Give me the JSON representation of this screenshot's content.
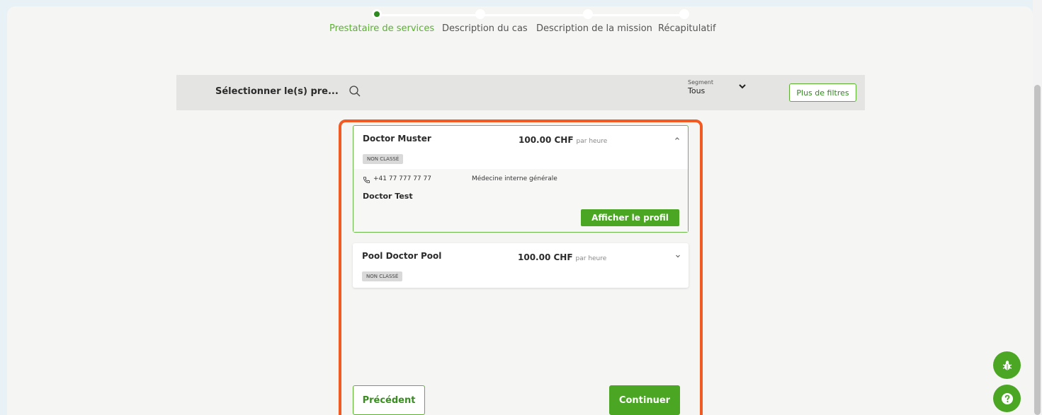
{
  "stepper": {
    "steps": [
      {
        "label": "Prestataire de services",
        "active": true
      },
      {
        "label": "Description du cas",
        "active": false
      },
      {
        "label": "Description de la mission",
        "active": false
      },
      {
        "label": "Récapitulatif",
        "active": false
      }
    ]
  },
  "filter": {
    "title": "Sélectionner le(s) pre...",
    "segment_label": "Segment",
    "segment_value": "Tous",
    "more_filters": "Plus de filtres"
  },
  "providers": [
    {
      "name": "Doctor Muster",
      "price": "100.00 CHF",
      "unit": "par heure",
      "badge": "NON CLASSÉ",
      "expanded": true,
      "phone": "+41 77 777 77 77",
      "specialty": "Médecine interne générale",
      "contact": "Doctor Test",
      "profile_button": "Afficher le profil"
    },
    {
      "name": "Pool Doctor Pool",
      "price": "100.00 CHF",
      "unit": "par heure",
      "badge": "NON CLASSÉ",
      "expanded": false
    }
  ],
  "actions": {
    "previous": "Précédent",
    "continue": "Continuer"
  },
  "colors": {
    "accent": "#4aa623",
    "highlight": "#f15a22"
  },
  "icons": {
    "search": "search-icon",
    "segment_toggle": "chevron-down-icon",
    "phone": "phone-icon",
    "bug": "bug-icon",
    "help": "help-icon"
  }
}
